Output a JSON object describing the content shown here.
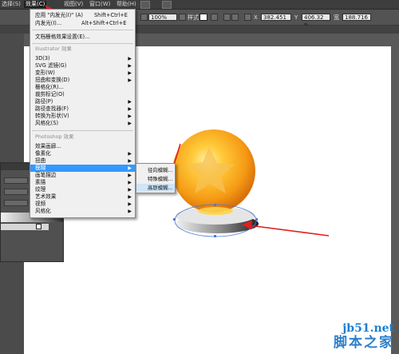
{
  "menubar": {
    "items": [
      {
        "label": "选择(S)",
        "active": false
      },
      {
        "label": "效果(C)",
        "active": true
      },
      {
        "label": "视图(V)",
        "active": false
      },
      {
        "label": "窗口(W)",
        "active": false
      },
      {
        "label": "帮助(H)",
        "active": false
      }
    ]
  },
  "toolbar": {
    "zoom": "100%",
    "style_label": "样式",
    "x_label": "X",
    "x_value": "382.451",
    "y_label": "Y",
    "y_value": "406.32 p",
    "w_label": "宽",
    "w_value": "188.716"
  },
  "effect_menu": {
    "apply_last": {
      "label": "应用 \"内发光(I)\" (A)",
      "shortcut": "Shift+Ctrl+E"
    },
    "last_effect": {
      "label": "内发光(I)...",
      "shortcut": "Alt+Shift+Ctrl+E"
    },
    "raster_settings": "文档栅格效果设置(E)...",
    "illustrator_header": "Illustrator 效果",
    "illustrator_items": [
      "3D(3)",
      "SVG 滤镜(G)",
      "变形(W)",
      "扭曲和变换(D)",
      "栅格化(R)...",
      "裁剪标记(O)",
      "路径(P)",
      "路径查找器(F)",
      "转换为形状(V)",
      "风格化(S)"
    ],
    "photoshop_header": "Photoshop 效果",
    "photoshop_items": [
      "效果画廊...",
      "像素化",
      "扭曲",
      "模糊",
      "画笔描边",
      "素描",
      "纹理",
      "艺术效果",
      "视频",
      "风格化"
    ],
    "highlighted": "模糊"
  },
  "blur_submenu": {
    "items": [
      "径向模糊...",
      "特殊模糊...",
      "高斯模糊..."
    ],
    "highlighted": "高斯模糊..."
  },
  "watermark": {
    "url": "jb51.net",
    "name": "脚本之家"
  },
  "colors": {
    "accent": "#3399ff",
    "arrow": "#e0201c",
    "orb": "#f7a21b",
    "menu_bg": "#f0f0f0"
  }
}
